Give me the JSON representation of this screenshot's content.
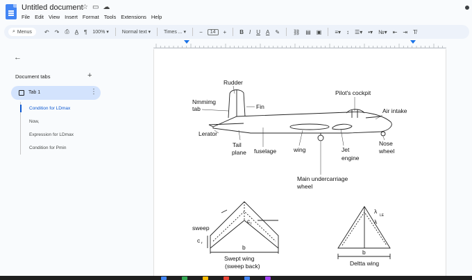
{
  "app": {
    "doc_title": "Untitled document",
    "menu": [
      "File",
      "Edit",
      "View",
      "Insert",
      "Format",
      "Tools",
      "Extensions",
      "Help"
    ]
  },
  "toolbar": {
    "menus_label": "Menus",
    "zoom": "100%",
    "style": "Normal text",
    "font": "Times ...",
    "font_size": "14",
    "bold": "B",
    "italic": "I",
    "underline": "U",
    "text_color": "A"
  },
  "sidebar": {
    "heading": "Document tabs",
    "tab": "Tab 1",
    "outline": [
      "Condition for LDmax",
      "Now,",
      "Expression for LDmax",
      "Condition for Pmin"
    ]
  },
  "diagram": {
    "aircraft": {
      "rudder": "Rudder",
      "nmmimg_1": "Nmmimg",
      "nmmimg_2": "tab",
      "fin": "Fin",
      "cockpit": "Pilot's cockpit",
      "air_intake": "Air intake",
      "lerator": "Lerator",
      "tail_1": "Tail",
      "tail_2": "plane",
      "fuselage": "fuselage",
      "wing": "wing",
      "jet_1": "Jet",
      "jet_2": "engine",
      "nose_1": "Nose",
      "nose_2": "wheel",
      "undercarriage_1": "Main undercarriage",
      "undercarriage_2": "wheel"
    },
    "swept": {
      "sweep": "sweep",
      "ct": "c",
      "ct_sub": "t",
      "cr": "c",
      "cr_sub": "r",
      "b": "b",
      "caption_1": "Swept wing",
      "caption_2": "(sweep back)"
    },
    "delta": {
      "lambda_le": "λ",
      "le_sub": "LE",
      "lambda": "λ",
      "b": "b",
      "caption": "Deltta wing"
    }
  },
  "colors": {
    "accent": "#0b57d0",
    "tab_bg": "#d3e3fd",
    "toolbar_bg": "#edf2fa"
  }
}
